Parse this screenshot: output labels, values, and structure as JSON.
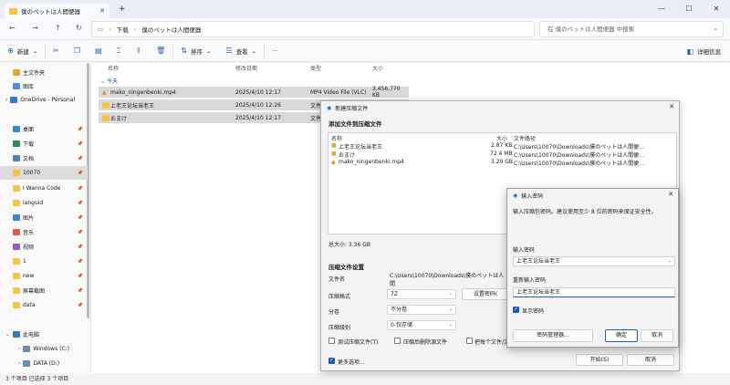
{
  "window": {
    "tab_title": "僕のペットは人間便器",
    "new_tab": "+",
    "controls": [
      "—",
      "☐",
      "✕"
    ]
  },
  "address": {
    "breadcrumb": [
      "下载",
      "僕のペットは人間便器"
    ],
    "search_placeholder": "在 僕のペットは人間便器 中搜索"
  },
  "toolbar": {
    "new": "新建",
    "sort": "排序",
    "view": "查看",
    "more": "···",
    "details": "详细信息"
  },
  "sidebar": {
    "items": [
      {
        "label": "主文件夹",
        "icon": "home-icon",
        "color": "#e0a93b"
      },
      {
        "label": "图库",
        "icon": "gallery-icon",
        "color": "#4a8fd9"
      },
      {
        "label": "OneDrive - Personal",
        "icon": "cloud-icon",
        "color": "#2f7bd4"
      },
      {
        "label": "桌面",
        "icon": "desktop-icon",
        "color": "#3b87d6"
      },
      {
        "label": "下载",
        "icon": "download-icon",
        "color": "#2d8a55"
      },
      {
        "label": "文档",
        "icon": "document-icon",
        "color": "#5a7fb8"
      },
      {
        "label": "10070",
        "icon": "folder-icon",
        "color": "#f6c445"
      },
      {
        "label": "I Wanna Code",
        "icon": "folder-icon",
        "color": "#f6c445"
      },
      {
        "label": "languid",
        "icon": "folder-icon",
        "color": "#f6c445"
      },
      {
        "label": "图片",
        "icon": "pictures-icon",
        "color": "#3d86d2"
      },
      {
        "label": "音乐",
        "icon": "music-icon",
        "color": "#e25b4b"
      },
      {
        "label": "视频",
        "icon": "video-icon",
        "color": "#8b5fd1"
      },
      {
        "label": "1",
        "icon": "folder-icon",
        "color": "#f6c445"
      },
      {
        "label": "new",
        "icon": "folder-icon",
        "color": "#f6c445"
      },
      {
        "label": "屏幕截图",
        "icon": "folder-icon",
        "color": "#f6c445"
      },
      {
        "label": "data",
        "icon": "folder-icon",
        "color": "#f6c445"
      },
      {
        "label": "此电脑",
        "icon": "computer-icon",
        "color": "#3a78c8"
      },
      {
        "label": "Windows (C:)",
        "icon": "drive-icon",
        "color": "#6a8bb0"
      },
      {
        "label": "DATA (D:)",
        "icon": "drive-icon",
        "color": "#6a8bb0"
      }
    ]
  },
  "filelist": {
    "headers": {
      "name": "名称",
      "modified": "修改日期",
      "type": "类型",
      "size": "大小"
    },
    "group": "今天",
    "rows": [
      {
        "name": "mako_ningenbenki.mp4",
        "modified": "2025/4/10 12:17",
        "type": "MP4 Video File (VLC)",
        "size": "3,456,770 KB"
      },
      {
        "name": "上老王论坛当老王",
        "modified": "2025/4/10 12:26",
        "type": "文件",
        "size": ""
      },
      {
        "name": "おまけ",
        "modified": "2025/4/10 12:17",
        "type": "文件",
        "size": ""
      }
    ]
  },
  "status": {
    "text": "3 个项目    已选择 3 个项目"
  },
  "compress": {
    "title": "新建压缩文件",
    "section_add": "添加文件到压缩文件",
    "list_headers": {
      "name": "名称",
      "size": "大小",
      "path": "文件路径"
    },
    "list_rows": [
      {
        "name": "上老王论坛当老王",
        "size": "2.87 KB",
        "path": "C:\\Users\\10070\\Downloads\\僕のペットは人間便..."
      },
      {
        "name": "おまけ",
        "size": "72.4 MB",
        "path": "C:\\Users\\10070\\Downloads\\僕のペットは人間便..."
      },
      {
        "name": "mako_ningenbenki.mp4",
        "size": "3.29 GB",
        "path": "C:\\Users\\10070\\Downloads\\僕のペットは人間便..."
      }
    ],
    "total": "总大小: 3.36 GB",
    "section_settings": "压缩文件设置",
    "filename_label": "文件名",
    "filename_value": "C:\\Users\\10070\\Downloads\\僕のペットは人間",
    "format_label": "压缩格式",
    "format_value": "7Z",
    "set_password": "设置密码(",
    "split_label": "分卷",
    "split_value": "不分卷",
    "level_label": "压缩级别",
    "level_value": "0-仅存储",
    "test_label": "测试压缩文件(T)",
    "delete_label": "压缩后删除源文件",
    "each_label": "把每个文件/文",
    "more_options": "更多选项...",
    "start_btn": "开始(S)",
    "cancel_btn": "取消"
  },
  "password": {
    "title": "输入密码",
    "hint": "输入压缩包密码。建议使用至少 8 位的密码来保证安全性。",
    "enter_label": "输入密码",
    "enter_value": "上老王论坛当老王",
    "confirm_label": "重新输入密码",
    "confirm_value": "上老王论坛当老王",
    "show_label": "显示密码",
    "manager_btn": "密码管理器...",
    "ok_btn": "确定",
    "cancel_btn": "取消"
  },
  "colors": {
    "accent": "#1e5fb3",
    "selection": "#d9d9d9",
    "folder": "#f6c445"
  }
}
